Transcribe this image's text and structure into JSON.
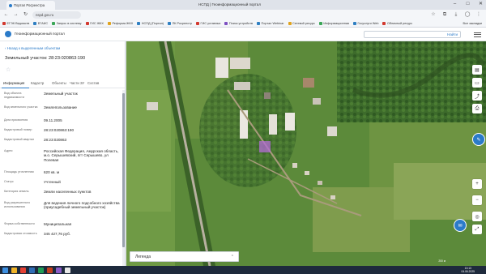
{
  "browser": {
    "tab_title": "Портал Росреестра",
    "window_title": "НСПД | Геоинформационный портал",
    "url": "nspd.gov.ru",
    "bookmarks": [
      {
        "label": "ЕГЭК Ведомств",
        "color": "#d2392f"
      },
      {
        "label": "ЕГАИС",
        "color": "#2f7fc2"
      },
      {
        "label": "Запрос в систему",
        "color": "#3aa657"
      },
      {
        "label": "ГИС ЖКХ",
        "color": "#d2392f"
      },
      {
        "label": "Реформа ЖКХ",
        "color": "#e0a31d"
      },
      {
        "label": "НСПД (Портал)",
        "color": "#2f7fc2"
      },
      {
        "label": "ПК Росреестр",
        "color": "#2f7fc2"
      },
      {
        "label": "ГИС уставных",
        "color": "#d2392f"
      },
      {
        "label": "Поиск устройств",
        "color": "#7d4fc1"
      },
      {
        "label": "Портал Webinar",
        "color": "#2f7fc2"
      },
      {
        "label": "Сетевой ресурс",
        "color": "#e0a31d"
      },
      {
        "label": "Информационная",
        "color": "#3aa657"
      },
      {
        "label": "Госуслуги Web",
        "color": "#2f7fc2"
      },
      {
        "label": "Облачный ресурс",
        "color": "#d2392f"
      }
    ],
    "bookmarks_more": "Все закладки"
  },
  "app": {
    "title": "Геоинформационный портал",
    "search_button": "Найти"
  },
  "panel": {
    "back_link": "Назад к выделенным объектам",
    "object_title": "Земельный участок: 28:23:020863:190",
    "tabs": [
      "Информация",
      "Кадастр",
      "Объекты",
      "Части ЗУ",
      "Состав"
    ],
    "rows": [
      {
        "key": "Вид объекта недвижимости",
        "value": "Земельный участок"
      },
      {
        "key": "Вид земельного участка",
        "value": "Землепользование"
      },
      {
        "key": "Дата присвоения",
        "value": "09.11.2005"
      },
      {
        "key": "Кадастровый номер",
        "value": "28:23:020863:190"
      },
      {
        "key": "Кадастровый квартал",
        "value": "28:23:020863"
      },
      {
        "key": "Адрес",
        "value": "Российская Федерация, Амурская область, м.о. Серышевский, пгт Серышево, ул Полевая"
      },
      {
        "key": "Площадь уточненная",
        "value": "620 кв. м"
      },
      {
        "key": "Статус",
        "value": "Учтенный"
      },
      {
        "key": "Категория земель",
        "value": "Земли населенных пунктов"
      },
      {
        "key": "Вид разрешенного использования",
        "value": "Для ведения личного подсобного хозяйства (приусадебный земельный участок)"
      },
      {
        "key": "Форма собственности",
        "value": "Муниципальная"
      },
      {
        "key": "Кадастровая стоимость",
        "value": "345 427,76 руб."
      }
    ]
  },
  "map": {
    "legend_label": "Легенда",
    "scale_text": "200 м"
  },
  "taskbar": {
    "time": "13:13",
    "date": "04.06.2025"
  }
}
